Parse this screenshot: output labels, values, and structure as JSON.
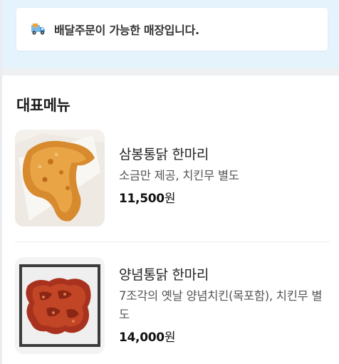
{
  "colors": {
    "top_band": "#e4f3fc",
    "card": "#ffffff",
    "text_primary": "#222222",
    "text_secondary": "#555555"
  },
  "notice": {
    "icon": "delivery-truck-icon",
    "text": "배달주문이 가능한 매장입니다."
  },
  "menu": {
    "section_title": "대표메뉴",
    "items": [
      {
        "name": "삼봉통닭 한마리",
        "description": "소금만 제공, 치킨무 별도",
        "price": "11,500",
        "currency": "원",
        "image": "whole-fried-chicken-photo"
      },
      {
        "name": "양념통닭 한마리",
        "description": "7조각의 옛날 양념치킨(목포함), 치킨무 별도",
        "price": "14,000",
        "currency": "원",
        "image": "seasoned-chicken-photo"
      }
    ]
  }
}
